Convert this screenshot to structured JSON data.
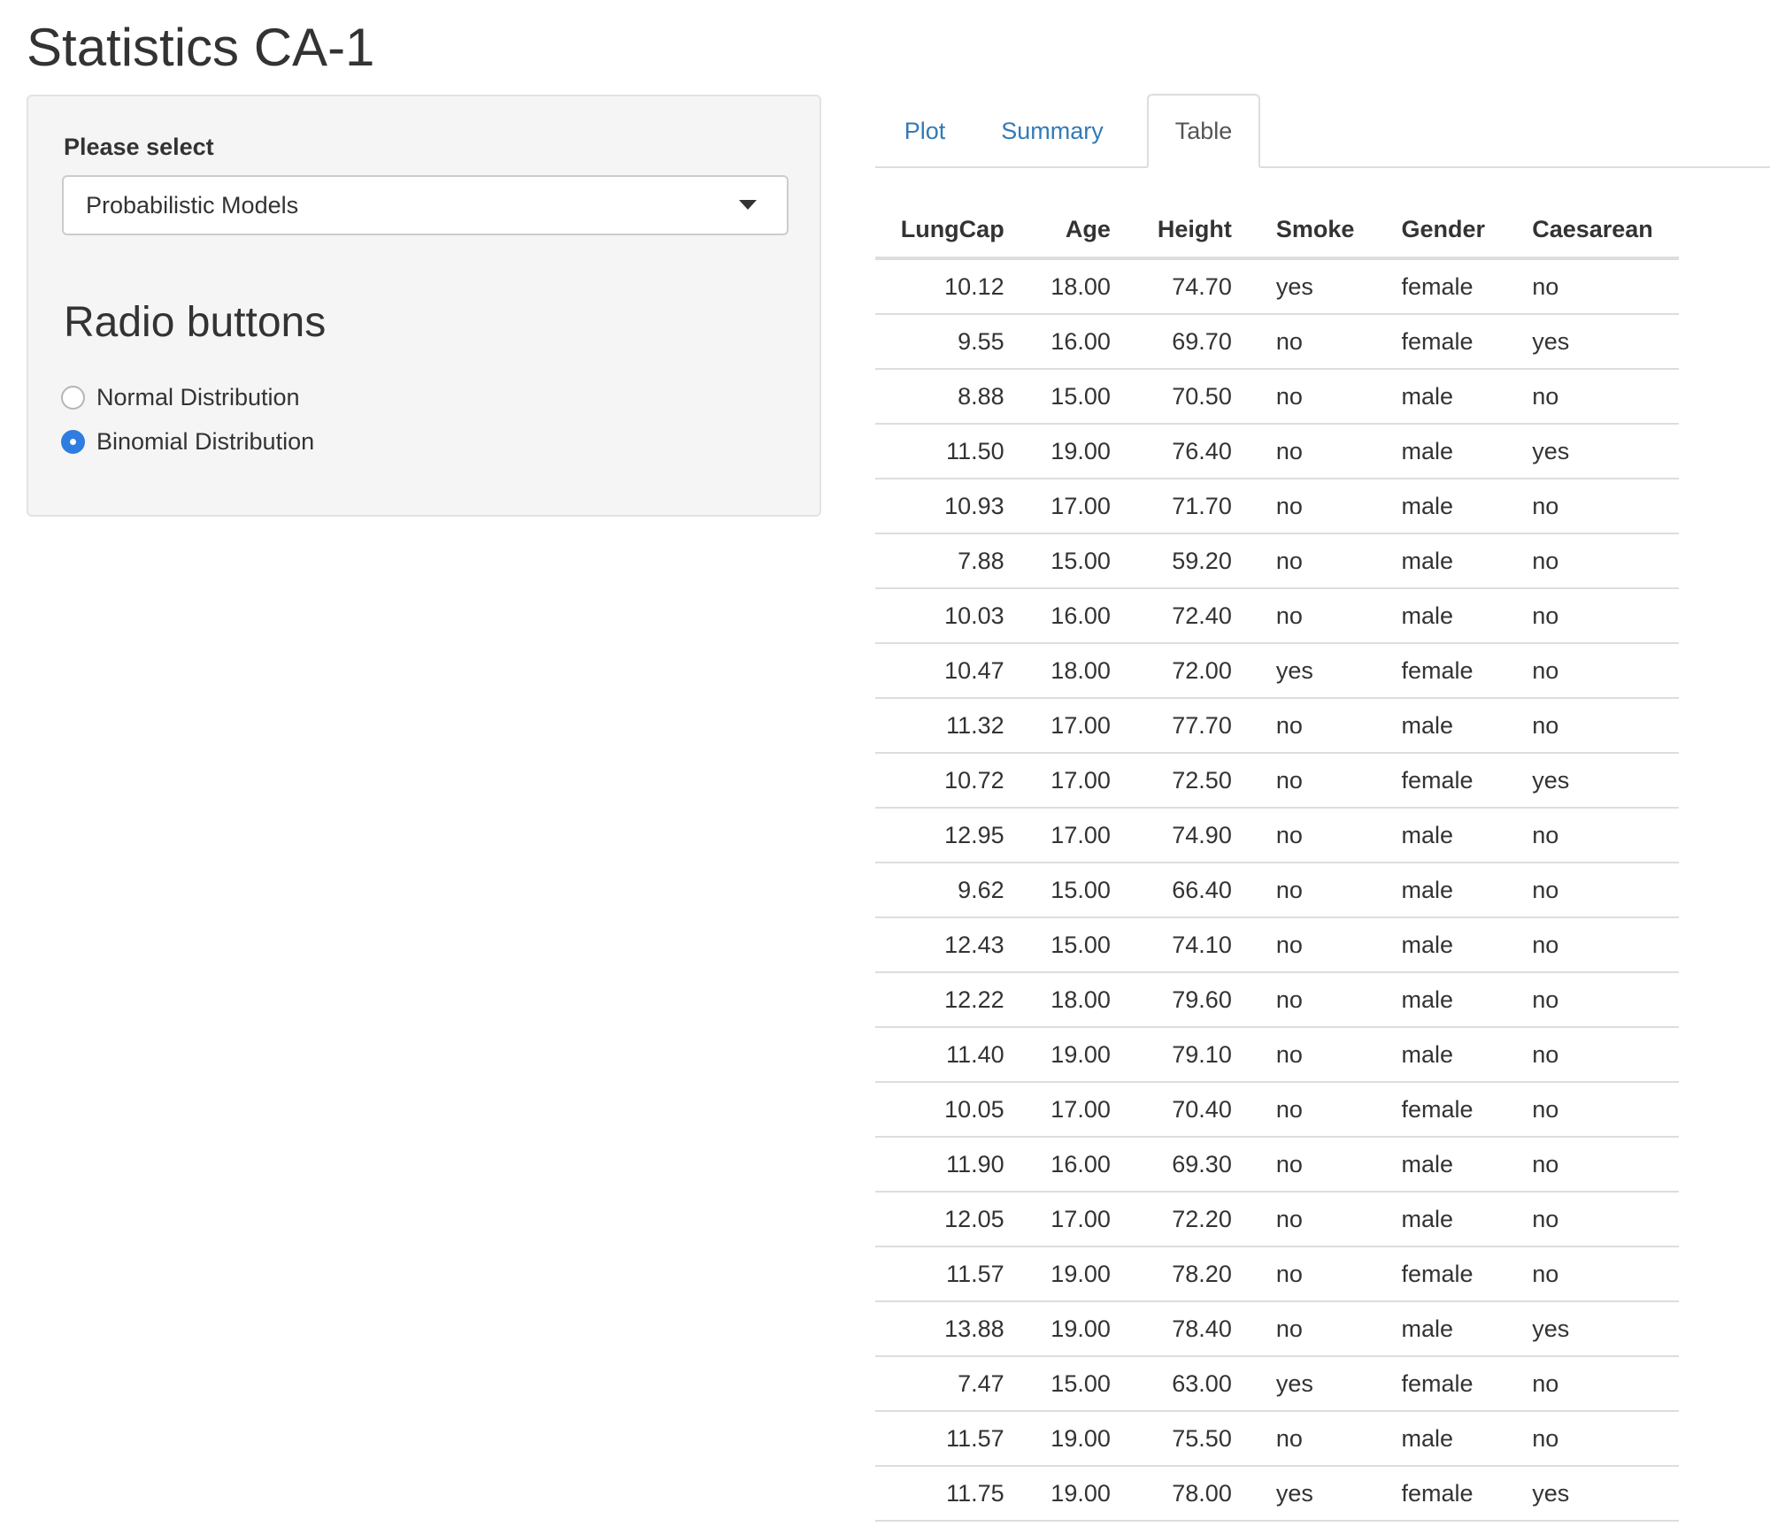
{
  "page_title": "Statistics CA-1",
  "sidebar": {
    "select_label": "Please select",
    "select_value": "Probabilistic Models",
    "radio_heading": "Radio buttons",
    "radio_options": [
      {
        "label": "Normal Distribution",
        "checked": false
      },
      {
        "label": "Binomial Distribution",
        "checked": true
      }
    ]
  },
  "tabs": [
    {
      "label": "Plot",
      "active": false
    },
    {
      "label": "Summary",
      "active": false
    },
    {
      "label": "Table",
      "active": true
    }
  ],
  "table": {
    "columns": [
      "LungCap",
      "Age",
      "Height",
      "Smoke",
      "Gender",
      "Caesarean"
    ],
    "rows": [
      [
        "10.12",
        "18.00",
        "74.70",
        "yes",
        "female",
        "no"
      ],
      [
        "9.55",
        "16.00",
        "69.70",
        "no",
        "female",
        "yes"
      ],
      [
        "8.88",
        "15.00",
        "70.50",
        "no",
        "male",
        "no"
      ],
      [
        "11.50",
        "19.00",
        "76.40",
        "no",
        "male",
        "yes"
      ],
      [
        "10.93",
        "17.00",
        "71.70",
        "no",
        "male",
        "no"
      ],
      [
        "7.88",
        "15.00",
        "59.20",
        "no",
        "male",
        "no"
      ],
      [
        "10.03",
        "16.00",
        "72.40",
        "no",
        "male",
        "no"
      ],
      [
        "10.47",
        "18.00",
        "72.00",
        "yes",
        "female",
        "no"
      ],
      [
        "11.32",
        "17.00",
        "77.70",
        "no",
        "male",
        "no"
      ],
      [
        "10.72",
        "17.00",
        "72.50",
        "no",
        "female",
        "yes"
      ],
      [
        "12.95",
        "17.00",
        "74.90",
        "no",
        "male",
        "no"
      ],
      [
        "9.62",
        "15.00",
        "66.40",
        "no",
        "male",
        "no"
      ],
      [
        "12.43",
        "15.00",
        "74.10",
        "no",
        "male",
        "no"
      ],
      [
        "12.22",
        "18.00",
        "79.60",
        "no",
        "male",
        "no"
      ],
      [
        "11.40",
        "19.00",
        "79.10",
        "no",
        "male",
        "no"
      ],
      [
        "10.05",
        "17.00",
        "70.40",
        "no",
        "female",
        "no"
      ],
      [
        "11.90",
        "16.00",
        "69.30",
        "no",
        "male",
        "no"
      ],
      [
        "12.05",
        "17.00",
        "72.20",
        "no",
        "male",
        "no"
      ],
      [
        "11.57",
        "19.00",
        "78.20",
        "no",
        "female",
        "no"
      ],
      [
        "13.88",
        "19.00",
        "78.40",
        "no",
        "male",
        "yes"
      ],
      [
        "7.47",
        "15.00",
        "63.00",
        "yes",
        "female",
        "no"
      ],
      [
        "11.57",
        "19.00",
        "75.50",
        "no",
        "male",
        "no"
      ],
      [
        "11.75",
        "19.00",
        "78.00",
        "yes",
        "female",
        "yes"
      ]
    ]
  },
  "colors": {
    "link": "#337ab7",
    "radio_checked": "#2f7de1",
    "panel_bg": "#f5f5f5",
    "border": "#dddddd"
  }
}
